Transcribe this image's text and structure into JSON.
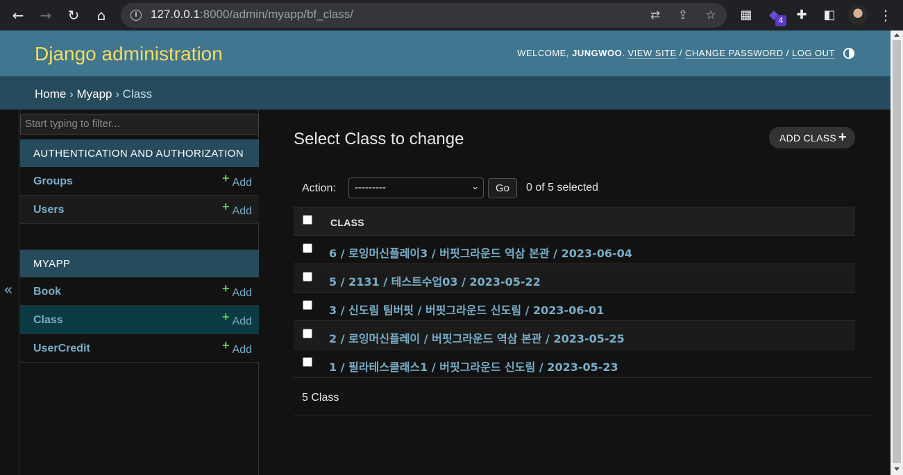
{
  "browser": {
    "url_host": "127.0.0.1",
    "url_rest": ":8000/admin/myapp/bf_class/",
    "extension_badge": "4"
  },
  "header": {
    "branding": "Django administration",
    "welcome": "Welcome,",
    "username": "jungwoo",
    "view_site": "View site",
    "change_password": "Change password",
    "log_out": "Log out"
  },
  "breadcrumbs": {
    "home": "Home",
    "app": "Myapp",
    "current": "Class",
    "sep": " › "
  },
  "sidebar": {
    "filter_placeholder": "Start typing to filter...",
    "toggle": "«",
    "modules": [
      {
        "caption": "Authentication and Authorization",
        "models": [
          {
            "name": "Groups",
            "add": "Add"
          },
          {
            "name": "Users",
            "add": "Add"
          }
        ]
      },
      {
        "caption": "Myapp",
        "models": [
          {
            "name": "Book",
            "add": "Add"
          },
          {
            "name": "Class",
            "add": "Add"
          },
          {
            "name": "UserCredit",
            "add": "Add"
          }
        ]
      }
    ]
  },
  "content": {
    "title": "Select Class to change",
    "add_button": "ADD CLASS",
    "action_label": "Action:",
    "action_select": "---------",
    "go": "Go",
    "selected": "0 of 5 selected",
    "column": "CLASS",
    "rows": [
      "6 / 로잉머신플레이3 / 버핏그라운드 역삼 본관 / 2023-06-04",
      "5 / 2131 / 테스트수업03 / 2023-05-22",
      "3 / 신도림 팀버핏 / 버핏그라운드 신도림 / 2023-06-01",
      "2 / 로잉머신플레이 / 버핏그라운드 역삼 본관 / 2023-05-25",
      "1 / 필라테스클래스1 / 버핏그라운드 신도림 / 2023-05-23"
    ],
    "paginator": "5 Class"
  }
}
